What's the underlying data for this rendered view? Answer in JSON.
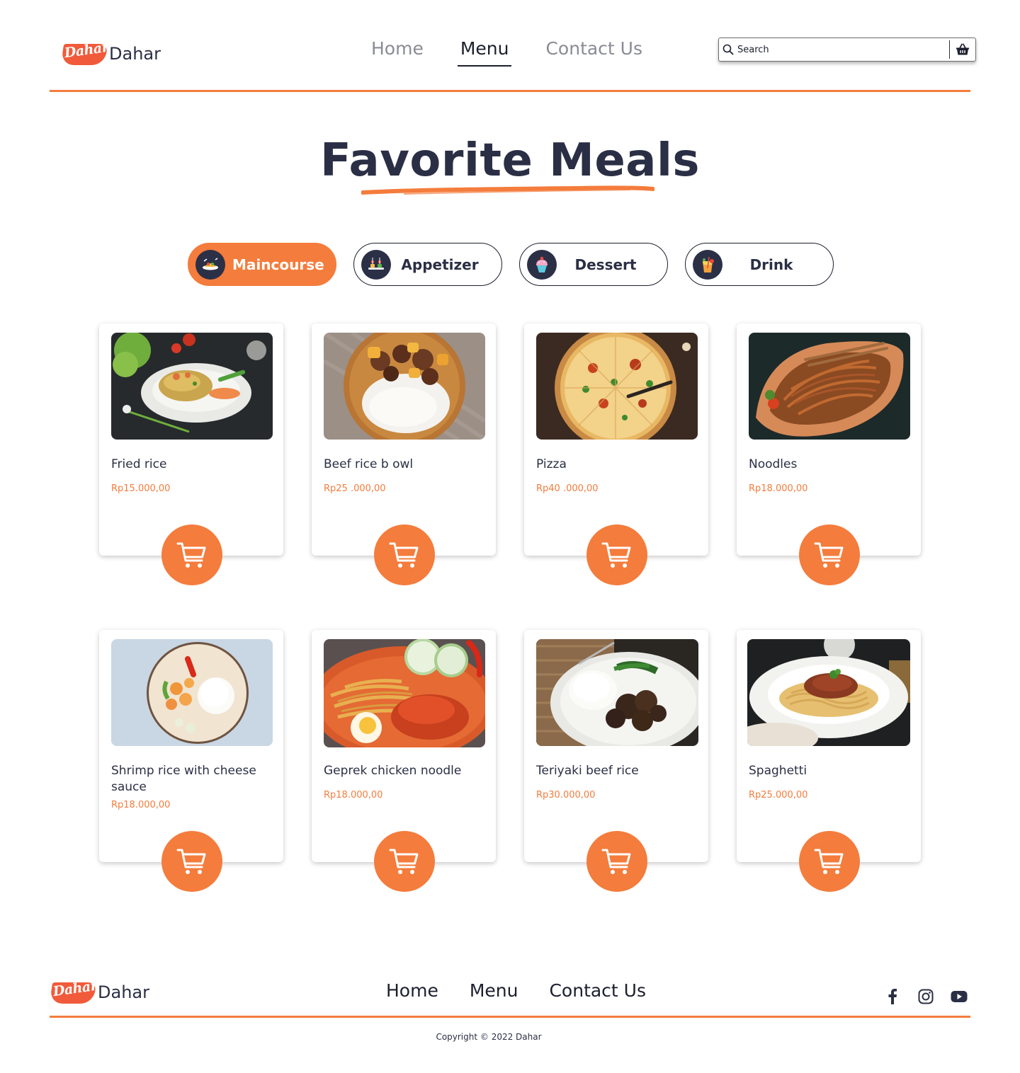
{
  "brand": {
    "logo_script": "Dahar",
    "name": "Dahar"
  },
  "nav": {
    "items": [
      {
        "label": "Home",
        "active": false
      },
      {
        "label": "Menu",
        "active": true
      },
      {
        "label": "Contact Us",
        "active": false
      }
    ]
  },
  "search": {
    "placeholder": "Search",
    "value": ""
  },
  "icons": {
    "search": "search-icon",
    "basket": "basket-icon",
    "cart": "cart-icon",
    "facebook": "facebook-icon",
    "instagram": "instagram-icon",
    "youtube": "youtube-icon"
  },
  "page_title": "Favorite Meals",
  "categories": [
    {
      "label": "Maincourse",
      "icon": "maincourse-icon",
      "active": true
    },
    {
      "label": "Appetizer",
      "icon": "appetizer-icon",
      "active": false
    },
    {
      "label": "Dessert",
      "icon": "dessert-icon",
      "active": false
    },
    {
      "label": "Drink",
      "icon": "drink-icon",
      "active": false
    }
  ],
  "menu_items": [
    {
      "name": "Fried rice",
      "price": "Rp15.000,00"
    },
    {
      "name": "Beef rice b owl",
      "price": "Rp25 .000,00"
    },
    {
      "name": "Pizza",
      "price": "Rp40 .000,00"
    },
    {
      "name": "Noodles",
      "price": "Rp18.000,00"
    },
    {
      "name": "Shrimp rice with cheese sauce",
      "price": "Rp18.000,00"
    },
    {
      "name": "Geprek chicken noodle",
      "price": "Rp18.000,00"
    },
    {
      "name": "Teriyaki beef rice",
      "price": "Rp30.000,00"
    },
    {
      "name": "Spaghetti",
      "price": "Rp25.000,00"
    }
  ],
  "footer": {
    "links": [
      {
        "label": "Home"
      },
      {
        "label": "Menu"
      },
      {
        "label": "Contact Us"
      }
    ],
    "copyright": "Copyright © 2022 Dahar"
  },
  "colors": {
    "accent": "#f47c3c",
    "text": "#2b2f45",
    "icon_bg": "#2b3047"
  }
}
